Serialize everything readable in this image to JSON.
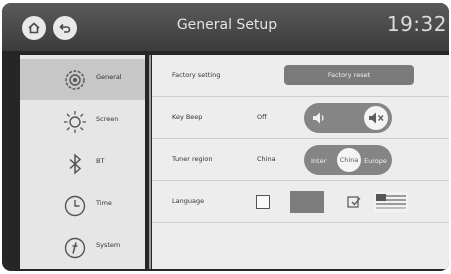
{
  "header": {
    "title": "General Setup",
    "time": "19:32"
  },
  "sidebar": {
    "items": [
      {
        "label": "General",
        "icon": "gear-icon",
        "active": true
      },
      {
        "label": "Screen",
        "icon": "brightness-icon",
        "active": false
      },
      {
        "label": "BT",
        "icon": "bluetooth-icon",
        "active": false
      },
      {
        "label": "Time",
        "icon": "clock-icon",
        "active": false
      },
      {
        "label": "System",
        "icon": "system-info-icon",
        "active": false
      }
    ]
  },
  "settings": {
    "factory": {
      "label": "Factory setting",
      "button": "Factory reset"
    },
    "key_beep": {
      "label": "Key Beep",
      "state": "Off"
    },
    "tuner_region": {
      "label": "Tuner region",
      "state": "China",
      "options": [
        "Inter",
        "China",
        "Europe"
      ],
      "selected": "China"
    },
    "language": {
      "label": "Language"
    }
  }
}
